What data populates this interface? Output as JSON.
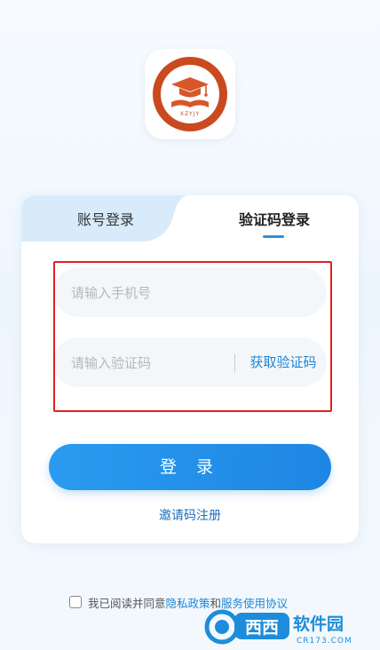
{
  "logo": {
    "text": "XZYJY",
    "colors": {
      "ring": "#c94a1f",
      "inner": "#ffffff",
      "cap": "#d8572a"
    }
  },
  "tabs": [
    {
      "label": "账号登录",
      "active": false
    },
    {
      "label": "验证码登录",
      "active": true
    }
  ],
  "form": {
    "phone_placeholder": "请输入手机号",
    "code_placeholder": "请输入验证码",
    "get_code_label": "获取验证码"
  },
  "login_label": "登 录",
  "invite_label": "邀请码注册",
  "agreement": {
    "prefix": "我已阅读并同意",
    "privacy": "隐私政策",
    "and": "和",
    "terms": "服务使用协议"
  },
  "watermark": {
    "brand": "西西",
    "site_name": "软件园",
    "domain": "CR173.COM"
  },
  "colors": {
    "accent": "#1e86e3",
    "highlight": "#e02020",
    "tab_bg": "#d7ebfb"
  }
}
